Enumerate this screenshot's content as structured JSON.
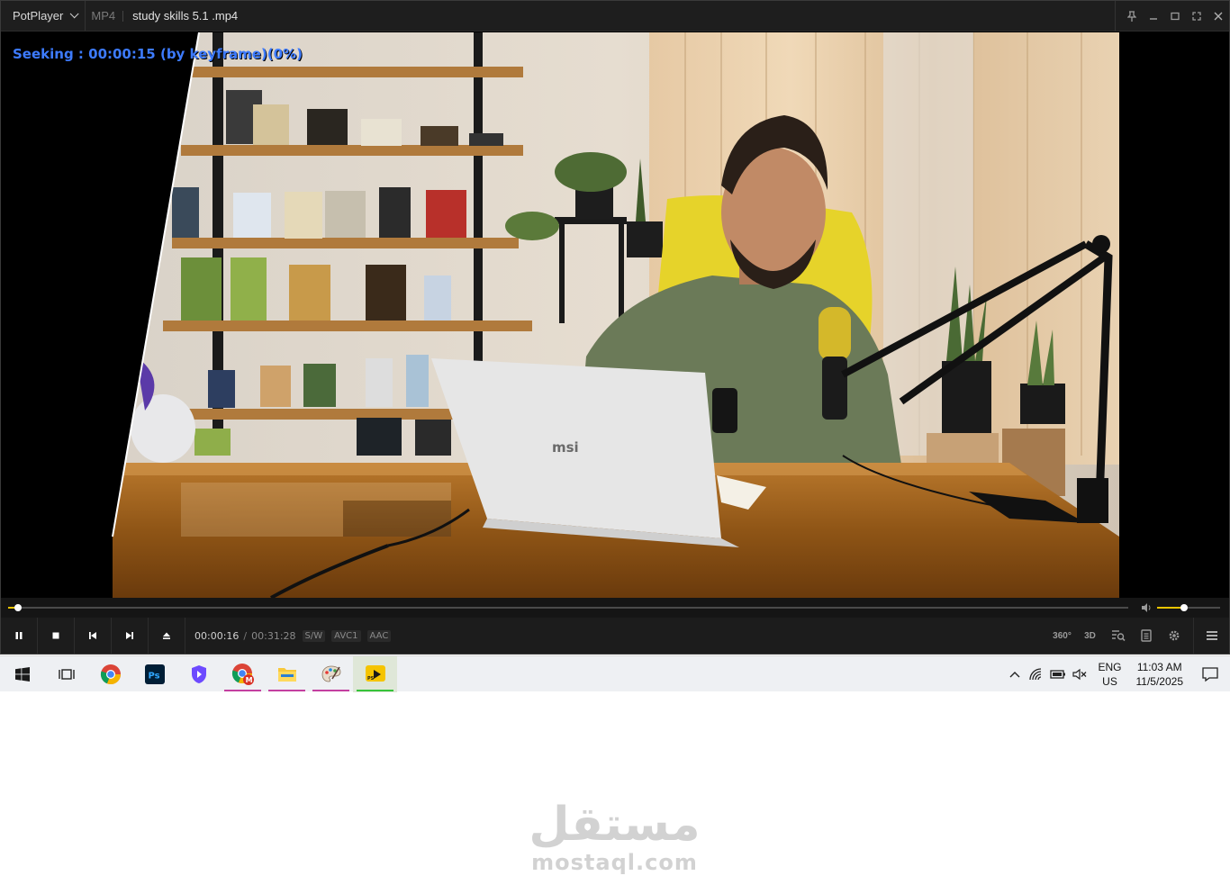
{
  "window": {
    "app_name": "PotPlayer",
    "format": "MP4",
    "filename": "study skills 5.1 .mp4"
  },
  "video": {
    "osd_text": "Seeking : 00:00:15 (by keyframe)(0%)",
    "laptop_brand": "msi"
  },
  "playback": {
    "seek_fraction": 0.0085,
    "volume_fraction": 0.43,
    "current_time": "00:00:16",
    "separator": "/",
    "total_time": "00:31:28",
    "tags": [
      "S/W",
      "AVC1",
      "AAC"
    ]
  },
  "right_controls": {
    "btn_360": "360°",
    "btn_3d": "3D"
  },
  "taskbar": {
    "lang_top": "ENG",
    "lang_bottom": "US",
    "time": "11:03 AM",
    "date": "11/5/2025"
  },
  "watermark": {
    "arabic": "مستقل",
    "latin": "mostaql.com"
  },
  "colors": {
    "osd": "#3d7bff",
    "accent": "#e8c400",
    "taskbar_active": "#36c33a",
    "taskbar_running": "#c43fa0"
  }
}
